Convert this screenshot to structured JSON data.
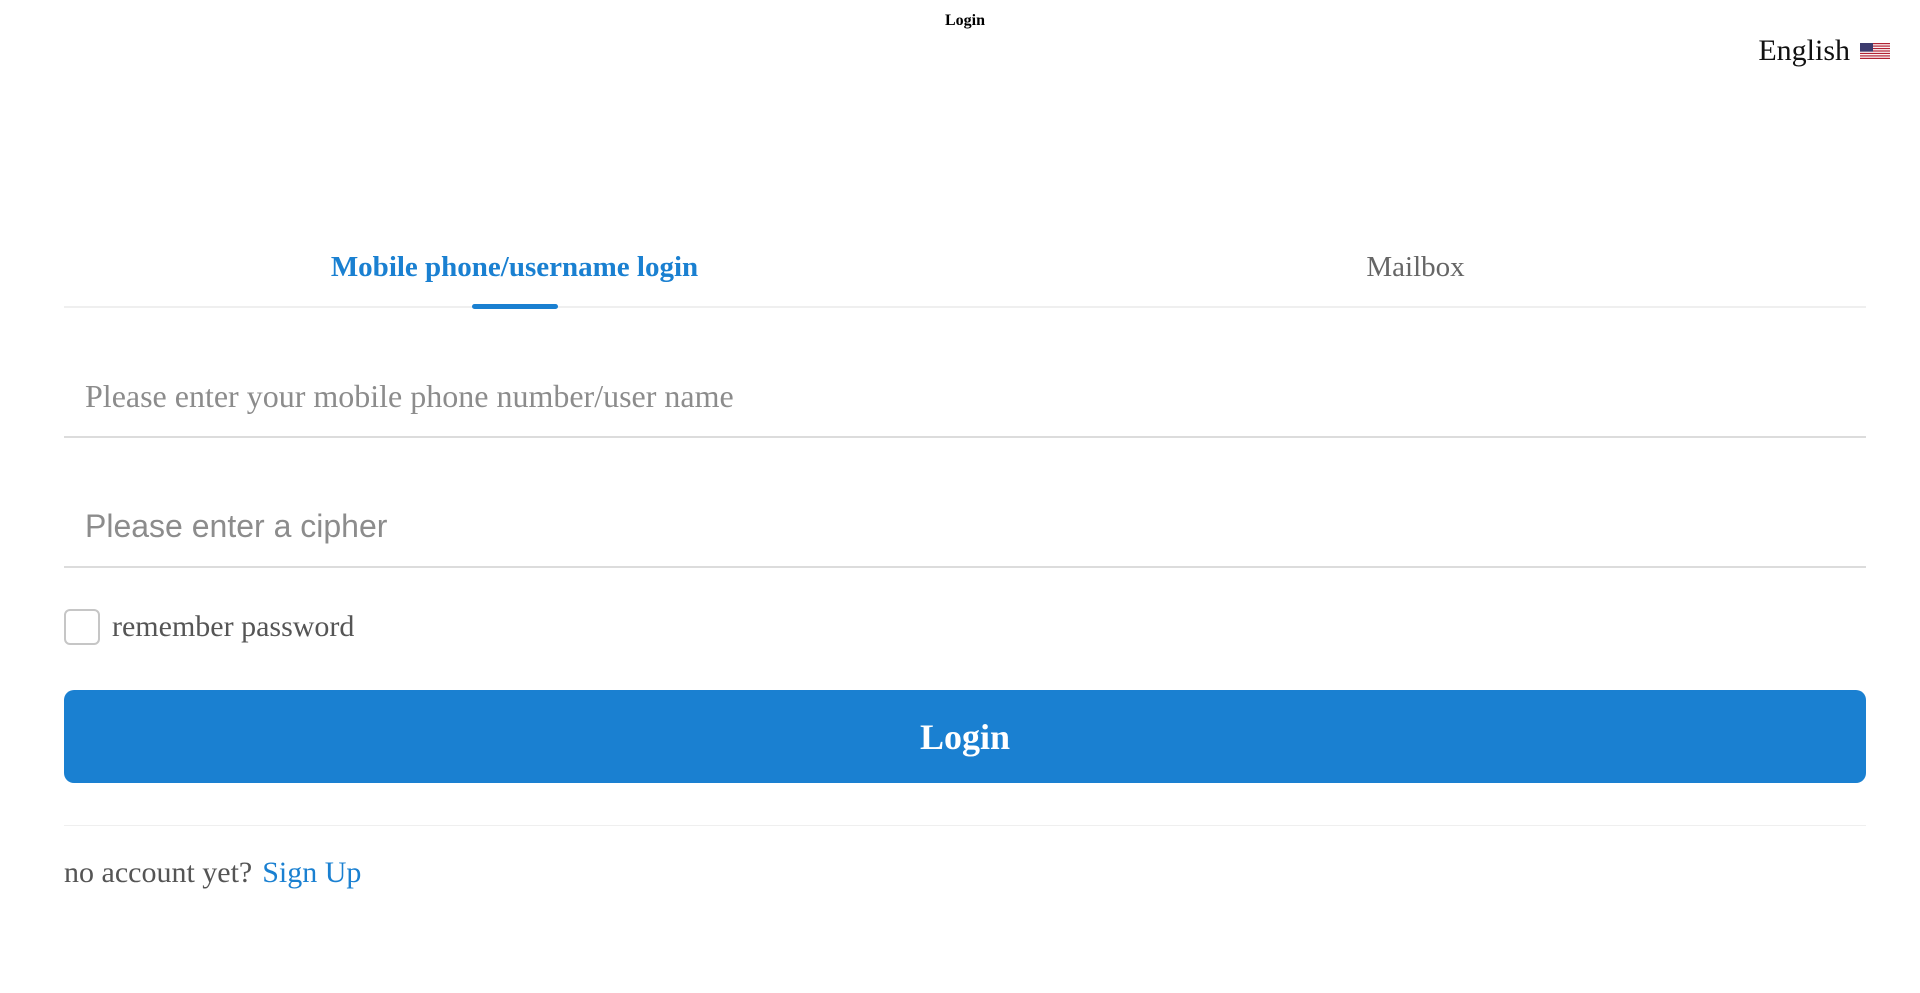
{
  "header": {
    "title": "Login",
    "language": {
      "label": "English",
      "flag_icon": "us-flag-icon"
    }
  },
  "tabs": [
    {
      "label": "Mobile phone/username login",
      "active": true
    },
    {
      "label": "Mailbox",
      "active": false
    }
  ],
  "form": {
    "username_placeholder": "Please enter your mobile phone number/user name",
    "password_placeholder": "Please enter a cipher",
    "remember_label": "remember password",
    "remember_checked": false,
    "submit_label": "Login"
  },
  "footer": {
    "prompt": "no account yet?",
    "signup_label": "Sign Up"
  },
  "colors": {
    "accent": "#1a80d1",
    "text_muted": "#666666",
    "divider": "#efefef"
  }
}
